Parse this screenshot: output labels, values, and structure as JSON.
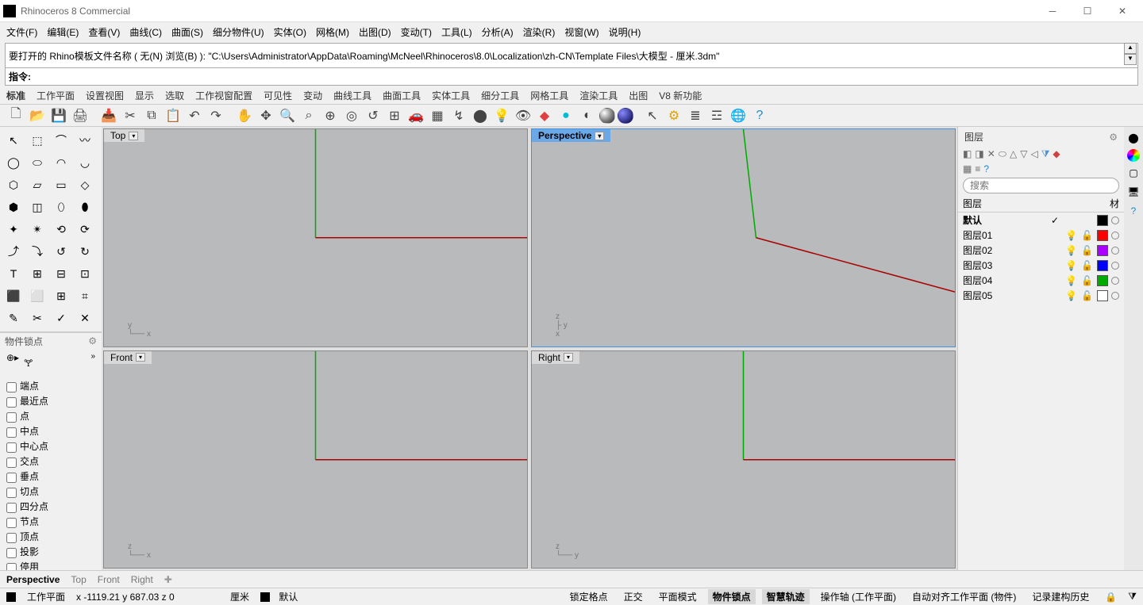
{
  "title": "Rhinoceros 8 Commercial",
  "menus": [
    "文件(F)",
    "编辑(E)",
    "查看(V)",
    "曲线(C)",
    "曲面(S)",
    "细分物件(U)",
    "实体(O)",
    "网格(M)",
    "出图(D)",
    "变动(T)",
    "工具(L)",
    "分析(A)",
    "渲染(R)",
    "视窗(W)",
    "说明(H)"
  ],
  "cmd_history": "要打开的 Rhino模板文件名称 ( 无(N)  浏览(B) ): \"C:\\Users\\Administrator\\AppData\\Roaming\\McNeel\\Rhinoceros\\8.0\\Localization\\zh-CN\\Template Files\\大模型 - 厘米.3dm\"",
  "cmd_label": "指令:",
  "tabs": [
    "标准",
    "工作平面",
    "设置视图",
    "显示",
    "选取",
    "工作视窗配置",
    "可见性",
    "变动",
    "曲线工具",
    "曲面工具",
    "实体工具",
    "细分工具",
    "网格工具",
    "渲染工具",
    "出图",
    "V8 新功能"
  ],
  "viewports": {
    "top": "Top",
    "perspective": "Perspective",
    "front": "Front",
    "right": "Right"
  },
  "osnap_title": "物件锁点",
  "osnaps": [
    "端点",
    "最近点",
    "点",
    "中点",
    "中心点",
    "交点",
    "垂点",
    "切点",
    "四分点",
    "节点",
    "顶点",
    "投影",
    "停用"
  ],
  "layers_title": "图层",
  "search_placeholder": "搜索",
  "layer_header": {
    "name": "图层",
    "mat": "材"
  },
  "layers": [
    {
      "name": "默认",
      "current": true,
      "color": "#000000"
    },
    {
      "name": "图层01",
      "current": false,
      "color": "#ff0000"
    },
    {
      "name": "图层02",
      "current": false,
      "color": "#aa00ff"
    },
    {
      "name": "图层03",
      "current": false,
      "color": "#0000ff"
    },
    {
      "name": "图层04",
      "current": false,
      "color": "#00aa00"
    },
    {
      "name": "图层05",
      "current": false,
      "color": "#ffffff"
    }
  ],
  "view_tabs": [
    "Perspective",
    "Top",
    "Front",
    "Right"
  ],
  "status": {
    "cplane": "工作平面",
    "coords": "x -1119.21  y 687.03  z 0",
    "units": "厘米",
    "layer": "默认",
    "toggles": [
      "锁定格点",
      "正交",
      "平面模式",
      "物件锁点",
      "智慧轨迹",
      "操作轴 (工作平面)",
      "自动对齐工作平面 (物件)",
      "记录建构历史"
    ],
    "toggles_on": [
      3,
      4
    ]
  }
}
